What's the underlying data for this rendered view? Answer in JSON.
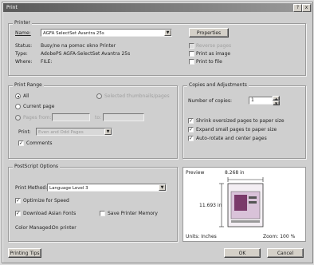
{
  "window": {
    "title": "Print",
    "help": "?",
    "close": "x"
  },
  "printer": {
    "group_label": "Printer",
    "name_label": "Name:",
    "name_value": "AGFA SelectSet Avantra 25s",
    "properties_label": "Properties",
    "status_label": "Status:",
    "status_value": "Busy/ne na pomoc okno Printer",
    "type_label": "Type:",
    "type_value": "AdobePS AGFA-SelectSet Avantra 25s",
    "where_label": "Where:",
    "where_value": "FILE:",
    "reverse_pages_label": "Reverse pages",
    "print_as_image_label": "Print as image",
    "print_to_file_label": "Print to file"
  },
  "print_range": {
    "group_label": "Print Range",
    "all_label": "All",
    "current_page_label": "Current page",
    "pages_from_label": "Pages from:",
    "to_label": "to:",
    "selected_thumbnails_label": "Selected thumbnails/pages",
    "print_label": "Print:",
    "print_value": "Even and Odd Pages",
    "comments_label": "Comments"
  },
  "copies": {
    "group_label": "Copies and Adjustments",
    "number_label": "Number of copies:",
    "number_value": "1",
    "shrink_label": "Shrink oversized pages to paper size",
    "expand_label": "Expand small pages to paper size",
    "autorotate_label": "Auto-rotate and center pages"
  },
  "postscript": {
    "group_label": "PostScript Options",
    "method_label": "Print Method:",
    "method_value": "Language Level 3",
    "optimize_label": "Optimize for Speed",
    "download_fonts_label": "Download Asian Fonts",
    "save_memory_label": "Save Printer Memory",
    "color_managed_label": "Color Managed:",
    "color_managed_value": "On printer"
  },
  "preview": {
    "label": "Preview",
    "width_dim": "8.268 in",
    "height_dim": "11.693 in",
    "units_label": "Units: Inches",
    "zoom_label": "Zoom: 100 %"
  },
  "buttons": {
    "printing_tips": "Printing Tips",
    "ok": "OK",
    "cancel": "Cancel"
  },
  "colors": {
    "accent": "#c0c0c0",
    "title_bar": "#5a5a5a"
  }
}
